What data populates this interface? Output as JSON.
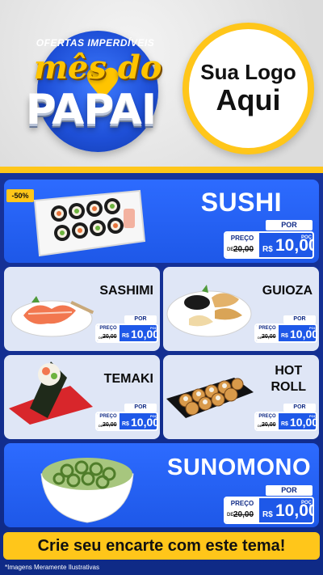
{
  "header": {
    "brand_top": "OFERTAS IMPERDÍVEIS",
    "brand_mes": "mês do",
    "brand_papai": "PAPAI",
    "logo_line1": "Sua Logo",
    "logo_line2": "Aqui"
  },
  "products": [
    {
      "name": "SUSHI",
      "discount": "-50%",
      "por": "POR",
      "preco": "PREÇO",
      "de": "DE",
      "old": "20,00",
      "cur": "R$",
      "value": "10,00",
      "unit": "POÇ"
    },
    {
      "name": "SASHIMI",
      "por": "POR",
      "preco": "PREÇO",
      "de": "DE",
      "old": "20,00",
      "cur": "R$",
      "value": "10,00",
      "unit": "POÇ"
    },
    {
      "name": "GUIOZA",
      "por": "POR",
      "preco": "PREÇO",
      "de": "DE",
      "old": "20,00",
      "cur": "R$",
      "value": "10,00",
      "unit": "POÇ"
    },
    {
      "name": "TEMAKI",
      "por": "POR",
      "preco": "PREÇO",
      "de": "DE",
      "old": "20,00",
      "cur": "R$",
      "value": "10,00",
      "unit": "POÇ"
    },
    {
      "name_line1": "HOT",
      "name_line2": "ROLL",
      "por": "POR",
      "preco": "PREÇO",
      "de": "DE",
      "old": "20,00",
      "cur": "R$",
      "value": "10,00",
      "unit": "POÇ"
    },
    {
      "name": "SUNOMONO",
      "por": "POR",
      "preco": "PREÇO",
      "de": "DE",
      "old": "20,00",
      "cur": "R$",
      "value": "10,00",
      "unit": "POÇ"
    }
  ],
  "cta": "Crie seu encarte com este tema!",
  "disclaimer": "*Imagens Meramente Ilustrativas",
  "colors": {
    "blue": "#1e58e8",
    "navy": "#0f2a86",
    "yellow": "#ffc61a"
  }
}
